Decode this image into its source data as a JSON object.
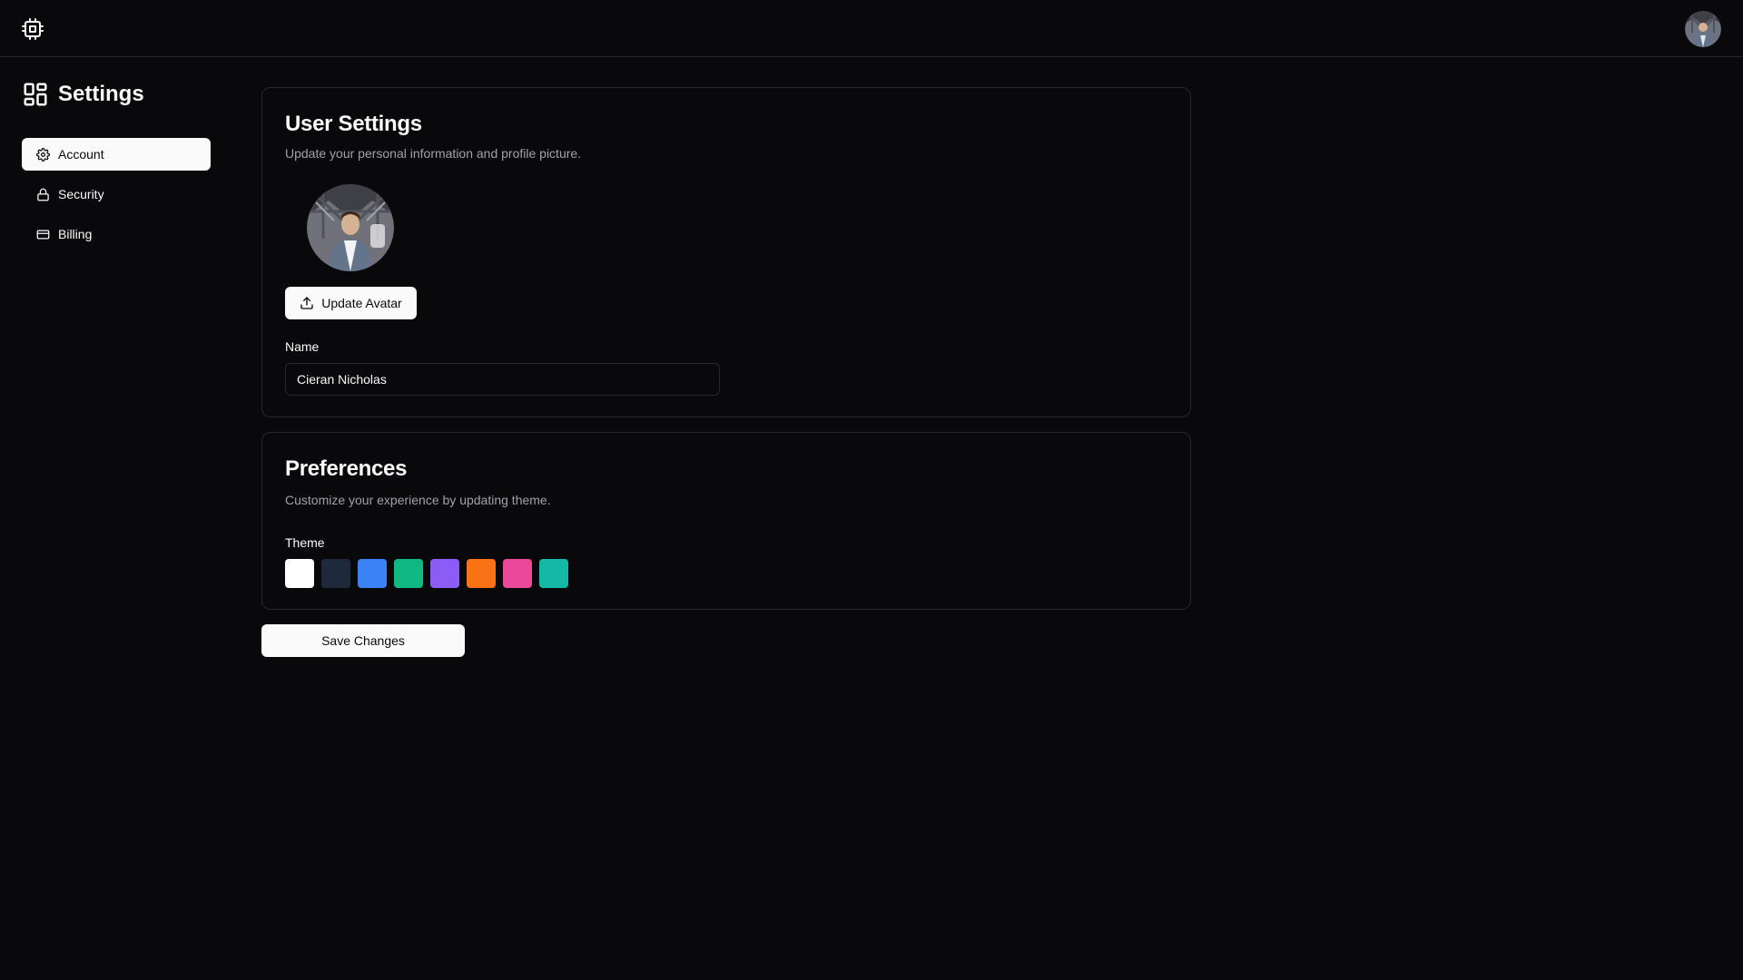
{
  "header": {
    "logo_icon": "cpu-icon",
    "avatar_icon": "user-avatar"
  },
  "sidebar": {
    "title": "Settings",
    "title_icon": "layout-dashboard-icon",
    "items": [
      {
        "label": "Account",
        "icon": "gear-icon",
        "active": true
      },
      {
        "label": "Security",
        "icon": "lock-icon",
        "active": false
      },
      {
        "label": "Billing",
        "icon": "credit-card-icon",
        "active": false
      }
    ]
  },
  "user_settings": {
    "title": "User Settings",
    "description": "Update your personal information and profile picture.",
    "update_avatar_label": "Update Avatar",
    "name_label": "Name",
    "name_value": "Cieran Nicholas"
  },
  "preferences": {
    "title": "Preferences",
    "description": "Customize your experience by updating theme.",
    "theme_label": "Theme",
    "theme_colors": [
      "#ffffff",
      "#1e293b",
      "#3b82f6",
      "#10b981",
      "#8b5cf6",
      "#f97316",
      "#ec4899",
      "#14b8a6"
    ]
  },
  "actions": {
    "save_label": "Save Changes"
  }
}
